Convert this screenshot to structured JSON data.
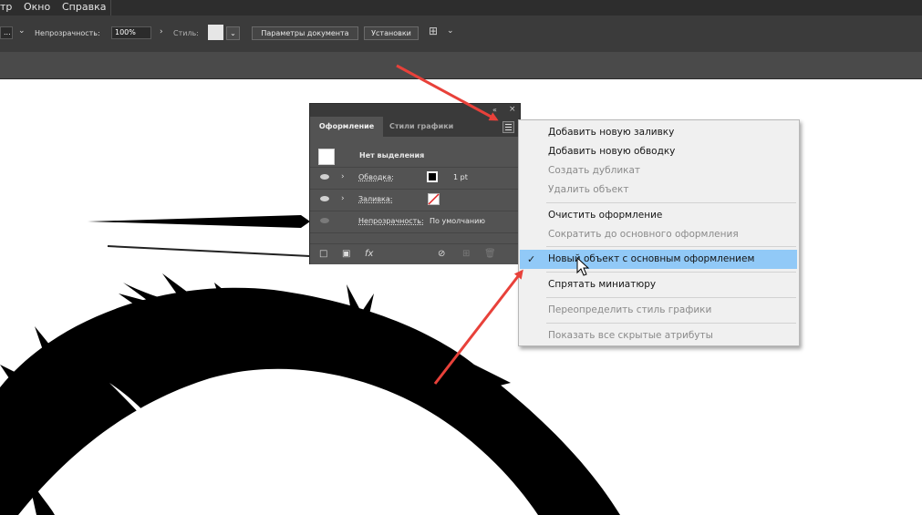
{
  "menubar": {
    "items": [
      "тр",
      "Окно",
      "Справка"
    ]
  },
  "controlbar": {
    "left_field": "...",
    "opacity_label": "Непрозрачность:",
    "opacity_value": "100%",
    "style_label": "Стиль:",
    "doc_settings_button": "Параметры документа",
    "preferences_button": "Установки"
  },
  "panel": {
    "tab_appearance": "Оформление",
    "tab_graphic_styles": "Стили графики",
    "no_selection": "Нет выделения",
    "stroke_label": "Обводка:",
    "stroke_weight": "1 pt",
    "fill_label": "Заливка:",
    "opacity_label": "Непрозрачность:",
    "opacity_value": "По умолчанию"
  },
  "flyout": {
    "items": [
      {
        "label": "Добавить новую заливку"
      },
      {
        "label": "Добавить новую обводку"
      },
      {
        "label": "Создать дубликат"
      },
      {
        "label": "Удалить объект"
      },
      {
        "label": "Очистить оформление"
      },
      {
        "label": "Сократить до основного оформления"
      },
      {
        "label": "Новый объект с основным оформлением"
      },
      {
        "label": "Спрятать миниатюру"
      },
      {
        "label": "Переопределить стиль графики"
      },
      {
        "label": "Показать все скрытые атрибуты"
      }
    ]
  },
  "colors": {
    "annotation_arrow": "#e8413a",
    "menu_highlight": "#91c9f7",
    "panel_bg": "#535353"
  }
}
